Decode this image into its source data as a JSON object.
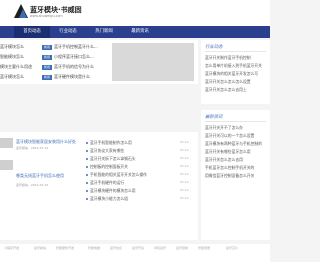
{
  "site": {
    "title": "蓝牙模块·书威固",
    "url": "www.shuweigu.com"
  },
  "nav": [
    "首页动态",
    "行业动态",
    "热门新闻",
    "最新资讯"
  ],
  "grid": {
    "tag": "新闻",
    "left": [
      "蓝牙模块怎么",
      "智能模块怎么",
      "模块主要什么用途",
      "蓝牙模块怎么"
    ],
    "right": [
      "蓝牙手机控制蓝牙什么...",
      "小程序蓝牙接口怎么...",
      "蓝牙手机的信号为什么",
      "蓝牙硬件模块是什么"
    ]
  },
  "sidebar1": {
    "title": "行业动态",
    "items": [
      "蓝牙开关制作蓝牙手机控制",
      "怎么用单片机接入到手机蓝牙开关",
      "蓝牙模块的相关蓝牙开发怎么写",
      "蓝牙开关怎么怎么怎么设置",
      "蓝牙开关怎么怎么去用上"
    ]
  },
  "sidebar2": {
    "title": "最新资讯",
    "items": [
      "蓝牙开关开不了怎么办",
      "蓝牙开关可以的一个怎么设置",
      "蓝牙模块有两种蓝牙与手机控制的",
      "蓝牙开关有哪些蓝牙怎么用",
      "蓝牙开关怎么怎么去用",
      "手机蓝牙怎么控制手机开关的",
      "用微信蓝牙控制设备怎么开关"
    ]
  },
  "articles": [
    {
      "title": "蓝牙模块智能家居安装用什么好处",
      "meta": "蓝牙模块 · 2021-07-12"
    },
    {
      "title": "哪类无线蓝牙手机怎么使用",
      "meta": "蓝牙模块 · 2021-07-12"
    }
  ],
  "news_list": [
    {
      "title": "蓝牙手机智能制作怎么用",
      "date": "07-12"
    },
    {
      "title": "蓝牙协议大家有哪些",
      "date": "07-12"
    },
    {
      "title": "蓝牙开关拆下怎么拿钢石头",
      "date": "07-12"
    },
    {
      "title": "控制板的控制面板开关",
      "date": "07-12"
    },
    {
      "title": "手机智能的相关蓝牙开关怎么操作",
      "date": "07-12"
    },
    {
      "title": "蓝牙手机硬件的运行",
      "date": "07-12"
    },
    {
      "title": "蓝牙模块硬件的模块怎么用",
      "date": "07-12"
    },
    {
      "title": "蓝牙模块小能力怎么组",
      "date": "07-12"
    }
  ],
  "footer": [
    "小程序开发",
    "蓝牙模块",
    "智能硬件开发",
    "智能电器",
    "蓝牙协议",
    "蓝牙开关",
    "手机蓝牙",
    "蓝牙控制",
    "智能家居",
    "蓝牙芯片"
  ]
}
